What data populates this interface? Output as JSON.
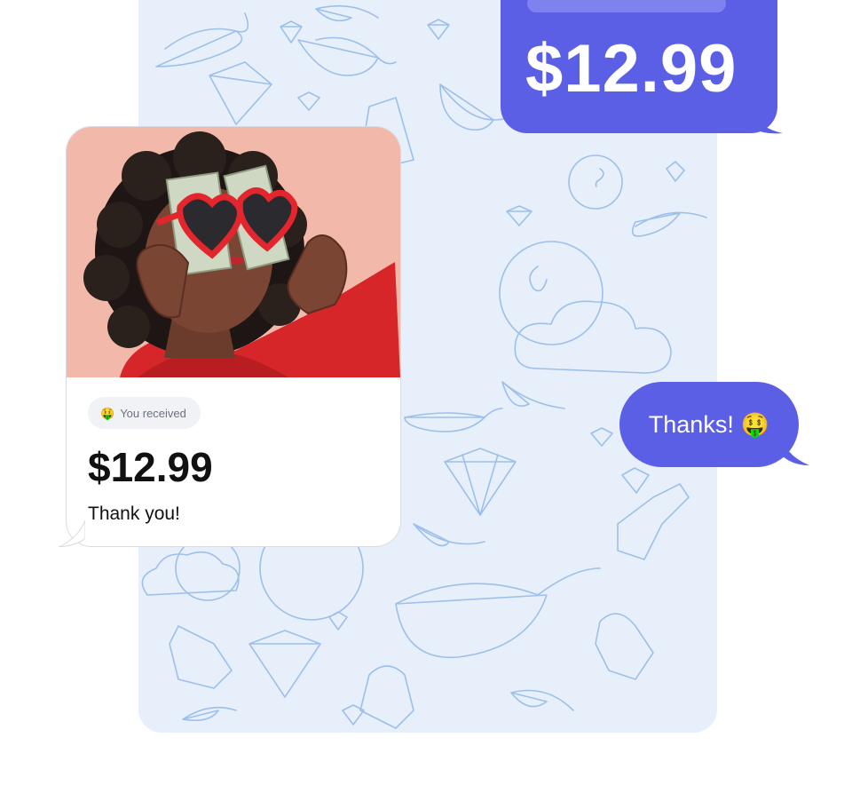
{
  "outgoing_price": {
    "amount": "$12.99",
    "bubble_color": "#5b5fe6"
  },
  "payment_card": {
    "photo": "woman-with-heart-sunglasses-and-dollar-bills",
    "received_emoji": "money-mouth-face",
    "received_emoji_glyph": "🤑",
    "received_label": "You received",
    "amount": "$12.99",
    "note": "Thank you!"
  },
  "reply": {
    "text": "Thanks!",
    "emoji": "money-mouth-face",
    "emoji_glyph": "🤑",
    "bubble_color": "#5b5fe6"
  },
  "colors": {
    "chat_background": "#e7effb",
    "doodle_stroke": "#9cc0ea",
    "accent": "#5b5fe6",
    "photo_background": "#f2b9ab"
  }
}
